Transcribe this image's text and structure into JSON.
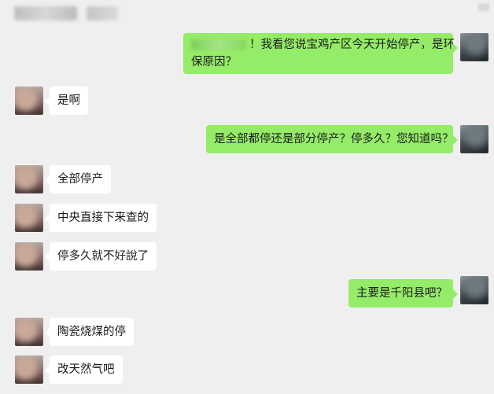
{
  "header": {
    "title": ""
  },
  "messages": [
    {
      "side": "right",
      "text": "！我看您说宝鸡产区今天开始停产，是环保原因？",
      "line1": "！我看您说宝鸡产区今天开始停产，是环",
      "line2": "保原因？"
    },
    {
      "side": "left",
      "text": "是啊"
    },
    {
      "side": "right",
      "text": "是全部都停还是部分停产？停多久？您知道吗？"
    },
    {
      "side": "left",
      "text": "全部停产"
    },
    {
      "side": "left",
      "text": "中央直接下来查的"
    },
    {
      "side": "left",
      "text": "停多久就不好說了"
    },
    {
      "side": "right",
      "text": "主要是千阳县吧？"
    },
    {
      "side": "left",
      "text": "陶瓷烧煤的停"
    },
    {
      "side": "left",
      "text": "改天然气吧"
    }
  ]
}
